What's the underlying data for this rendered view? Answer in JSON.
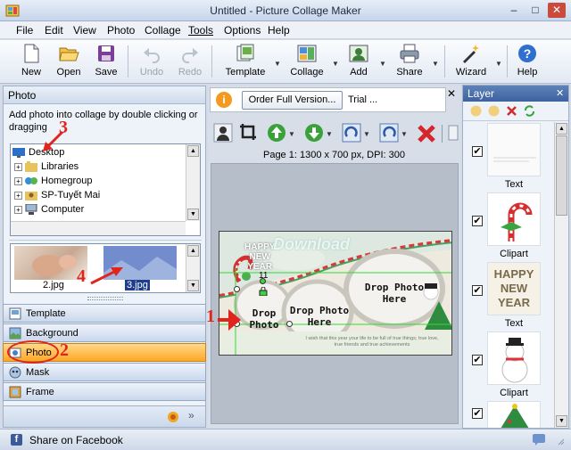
{
  "window": {
    "title": "Untitled - Picture Collage Maker",
    "min": "–",
    "max": "□",
    "close": "✕"
  },
  "menu": [
    "File",
    "Edit",
    "View",
    "Photo",
    "Collage",
    "Tools",
    "Options",
    "Help"
  ],
  "toolbar": {
    "new": "New",
    "open": "Open",
    "save": "Save",
    "undo": "Undo",
    "redo": "Redo",
    "template": "Template",
    "collage": "Collage",
    "add": "Add",
    "share": "Share",
    "wizard": "Wizard",
    "help": "Help",
    "dropdown_glyph": "▼"
  },
  "left_panel": {
    "title": "Photo",
    "hint": "Add photo into collage by double clicking or dragging",
    "tree": [
      {
        "label": "Desktop",
        "expander": ""
      },
      {
        "label": "Libraries",
        "expander": "+"
      },
      {
        "label": "Homegroup",
        "expander": "+"
      },
      {
        "label": "SP-Tuyết Mai",
        "expander": "+"
      },
      {
        "label": "Computer",
        "expander": "+"
      }
    ],
    "thumbnails": [
      {
        "name": "2.jpg",
        "selected": false
      },
      {
        "name": "3.jpg",
        "selected": true
      }
    ],
    "tabs": [
      {
        "label": "Template",
        "active": false,
        "icon": "template-icon"
      },
      {
        "label": "Background",
        "active": false,
        "icon": "background-icon"
      },
      {
        "label": "Photo",
        "active": true,
        "icon": "photo-icon"
      },
      {
        "label": "Mask",
        "active": false,
        "icon": "mask-icon"
      },
      {
        "label": "Frame",
        "active": false,
        "icon": "frame-icon"
      }
    ],
    "footer_chevron": "»"
  },
  "center": {
    "info_icon": "i",
    "order_button": "Order Full Version...",
    "trial_text": "Trial ...",
    "info_close": "✕",
    "page_info": "Page 1: 1300 x 700 px, DPI: 300",
    "canvas": {
      "happy_text": [
        "HAPPY",
        "NEW",
        "YEAR"
      ],
      "watermark": "Download",
      "drop_photo_1": "Drop\nPhoto",
      "drop_photo_2": "Drop Photo\nHere",
      "drop_photo_3": "Drop Photo\nHere",
      "small_label": "11",
      "wish_text": "I wish that this year your life to be full of true things; true love, true friends and true achievements"
    }
  },
  "layer_panel": {
    "title": "Layer",
    "close": "✕",
    "items": [
      {
        "name": "Text",
        "checked": true,
        "kind": "text"
      },
      {
        "name": "Clipart",
        "checked": true,
        "kind": "candy-cane"
      },
      {
        "name": "Text",
        "checked": true,
        "kind": "happy-new-year",
        "content": [
          "HAPPY",
          "NEW",
          "YEAR"
        ]
      },
      {
        "name": "Clipart",
        "checked": true,
        "kind": "snowman"
      },
      {
        "name": "",
        "checked": true,
        "kind": "tree"
      }
    ]
  },
  "status": {
    "share_label": "Share on Facebook",
    "fb_glyph": "f"
  },
  "annotations": [
    "1",
    "2",
    "3",
    "4"
  ],
  "colors": {
    "accent_orange": "#ffa825",
    "annotation_red": "#e0261c",
    "layer_header": "#3c62a0"
  }
}
